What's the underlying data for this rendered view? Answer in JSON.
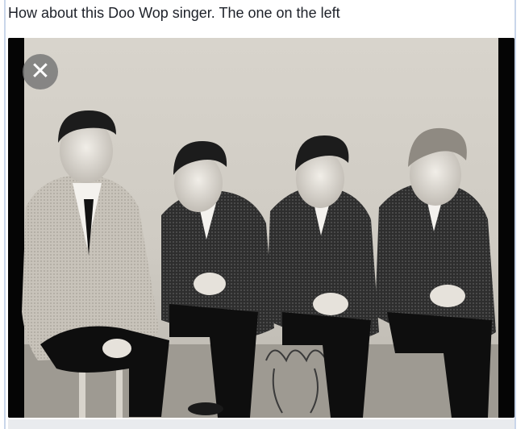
{
  "post": {
    "caption": "How about this Doo Wop singer. The one on the left"
  },
  "photo": {
    "subject": "vintage black-and-white group photo of four young men in suits"
  },
  "controls": {
    "close_icon": "close-icon",
    "close_glyph": "✕"
  },
  "colors": {
    "caption_text": "#1d2129",
    "frame_border": "#c9d6ea",
    "close_button_bg": "#787878"
  }
}
